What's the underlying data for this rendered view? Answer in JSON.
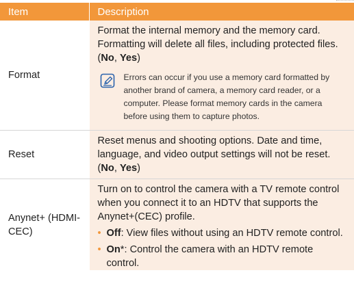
{
  "header": {
    "col_item": "Item",
    "col_description": "Description"
  },
  "rows": [
    {
      "item": "Format",
      "desc_main": "Format the internal memory and the memory card. Formatting will delete all files, including protected files. (",
      "opt_a": "No",
      "sep": ", ",
      "opt_b": "Yes",
      "close": ")",
      "note": "Errors can occur if you use a memory card formatted by another brand of camera, a memory card reader, or a computer. Please format memory cards in the camera before using them to capture photos.",
      "note_icon": "note-pencil-icon"
    },
    {
      "item": "Reset",
      "desc_main": "Reset menus and shooting options. Date and time, language, and video output settings will not be reset. (",
      "opt_a": "No",
      "sep": ", ",
      "opt_b": "Yes",
      "close": ")"
    },
    {
      "item": "Anynet+ (HDMI-CEC)",
      "desc_main": "Turn on to control the camera with a TV remote control when you connect it to an HDTV that supports the Anynet+(CEC) profile.",
      "bullets": [
        {
          "mark": "•",
          "label": "Off",
          "suffix": "",
          "text": ": View files without using an HDTV remote control."
        },
        {
          "mark": "•",
          "label": "On",
          "suffix": "*",
          "text": ": Control the camera with an HDTV remote control."
        }
      ]
    }
  ],
  "colors": {
    "header_bg": "#f2973a",
    "desc_bg": "#fbede2",
    "bullet": "#f2973a"
  }
}
